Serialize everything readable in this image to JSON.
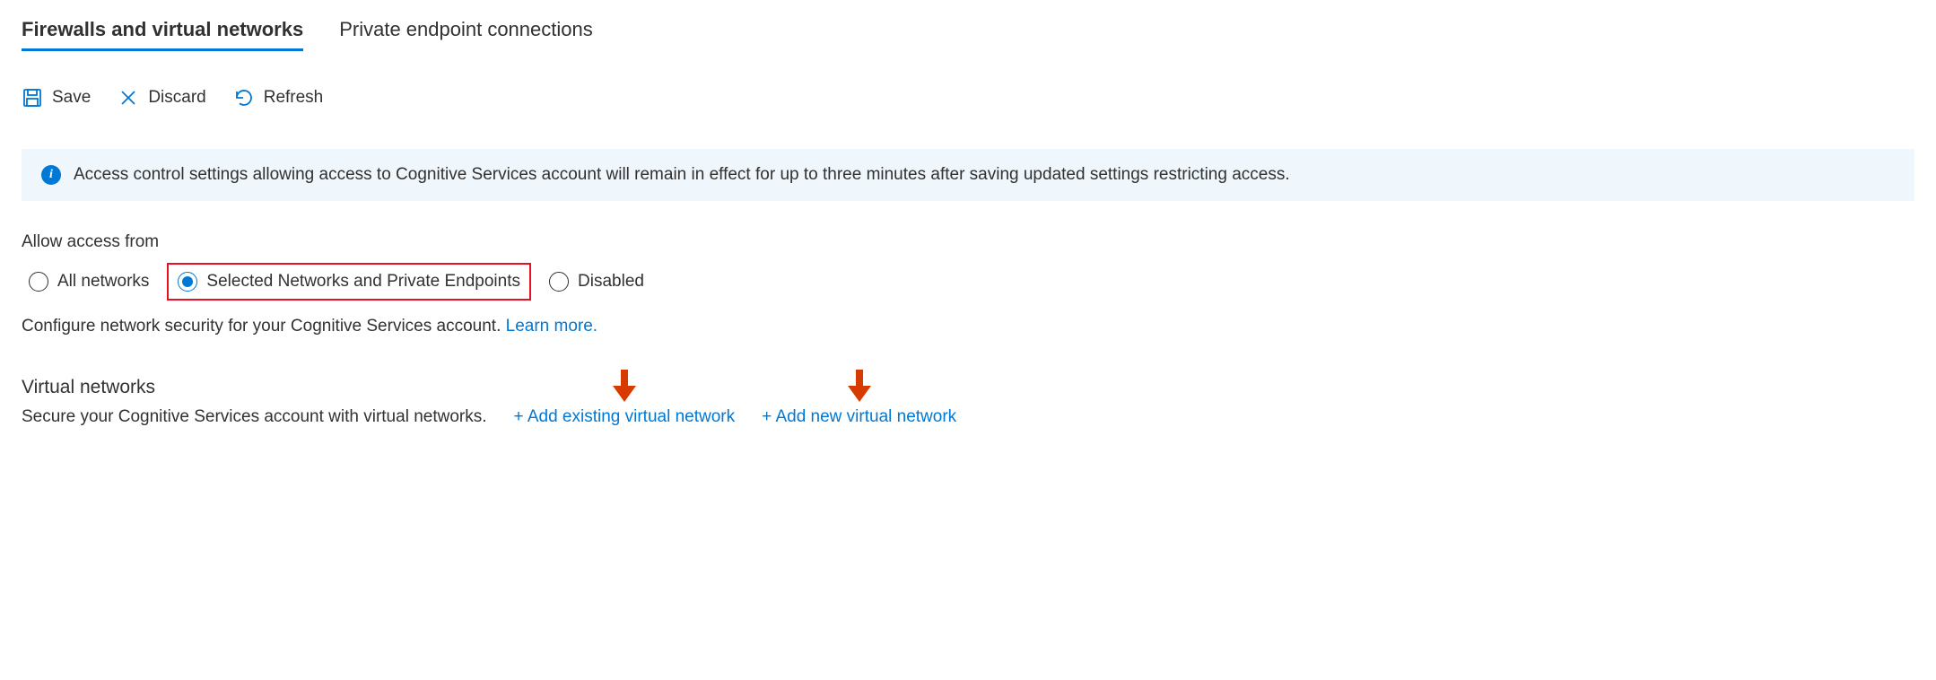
{
  "tabs": {
    "firewalls": "Firewalls and virtual networks",
    "private_endpoints": "Private endpoint connections"
  },
  "toolbar": {
    "save": "Save",
    "discard": "Discard",
    "refresh": "Refresh"
  },
  "info_message": "Access control settings allowing access to Cognitive Services account will remain in effect for up to three minutes after saving updated settings restricting access.",
  "allow_access": {
    "label": "Allow access from",
    "options": {
      "all": "All networks",
      "selected": "Selected Networks and Private Endpoints",
      "disabled": "Disabled"
    }
  },
  "description": {
    "text": "Configure network security for your Cognitive Services account. ",
    "link": "Learn more."
  },
  "virtual_networks": {
    "heading": "Virtual networks",
    "description": "Secure your Cognitive Services account with virtual networks.",
    "add_existing": "+ Add existing virtual network",
    "add_new": "+ Add new virtual network"
  }
}
